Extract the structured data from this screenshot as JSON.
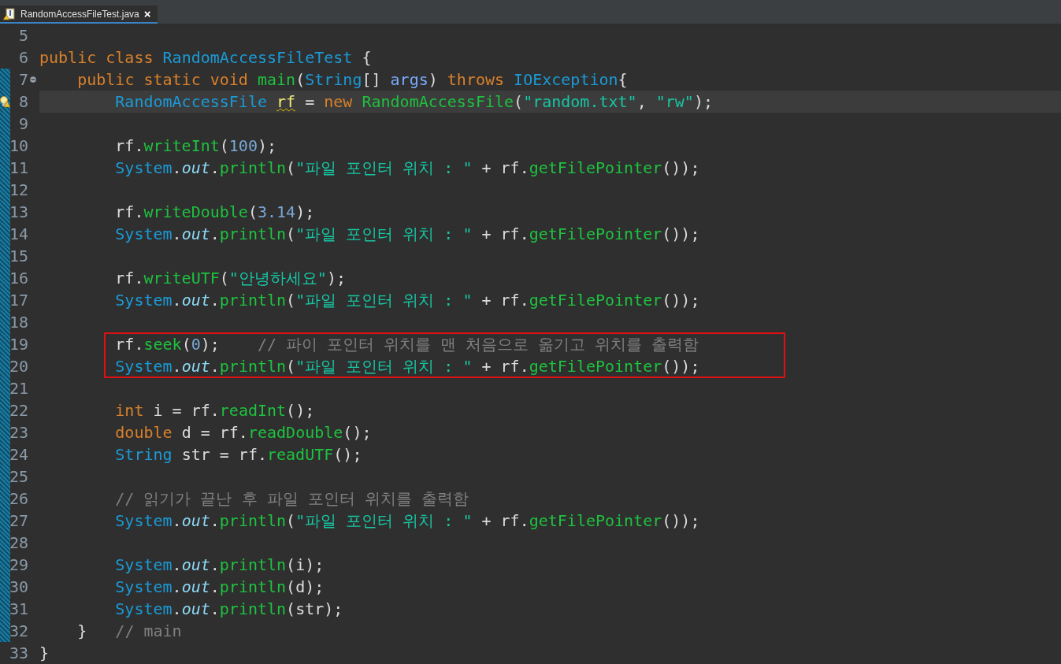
{
  "editor_tab": {
    "title": "RandomAccessFileTest.java",
    "selected": true,
    "close": "×"
  },
  "lines": [
    {
      "number": "5",
      "changed": false,
      "current": false,
      "boxed": false
    },
    {
      "number": "6",
      "changed": false,
      "current": false,
      "boxed": false,
      "tokens": [
        {
          "kind": "keyword",
          "text": "public class "
        },
        {
          "kind": "type",
          "text": "RandomAccessFileTest"
        },
        {
          "kind": "plain",
          "text": " {"
        }
      ]
    },
    {
      "number": "7",
      "changed": true,
      "current": false,
      "boxed": false,
      "fold": {
        "expanded": true
      },
      "tokens": [
        {
          "kind": "keyword",
          "text": "    public static void "
        },
        {
          "kind": "method",
          "text": "main"
        },
        {
          "kind": "plain",
          "text": "("
        },
        {
          "kind": "type",
          "text": "String"
        },
        {
          "kind": "plain",
          "text": "[] "
        },
        {
          "kind": "parameter",
          "text": "args"
        },
        {
          "kind": "plain",
          "text": ") "
        },
        {
          "kind": "keyword",
          "text": "throws "
        },
        {
          "kind": "type",
          "text": "IOException"
        },
        {
          "kind": "plain",
          "text": "{"
        }
      ]
    },
    {
      "number": "8",
      "changed": true,
      "current": true,
      "boxed": false,
      "warning": true,
      "tokens": [
        {
          "kind": "type",
          "text": "        RandomAccessFile "
        },
        {
          "kind": "variable",
          "text": "rf",
          "warning": true
        },
        {
          "kind": "plain",
          "text": " = "
        },
        {
          "kind": "keyword",
          "text": "new "
        },
        {
          "kind": "method",
          "text": "RandomAccessFile"
        },
        {
          "kind": "plain",
          "text": "("
        },
        {
          "kind": "string",
          "text": "\"random.txt\""
        },
        {
          "kind": "plain",
          "text": ", "
        },
        {
          "kind": "string",
          "text": "\"rw\""
        },
        {
          "kind": "plain",
          "text": ");"
        }
      ]
    },
    {
      "number": "9",
      "changed": true,
      "current": false,
      "boxed": false
    },
    {
      "number": "10",
      "changed": true,
      "current": false,
      "boxed": false,
      "tokens": [
        {
          "kind": "plain",
          "text": "        rf."
        },
        {
          "kind": "method",
          "text": "writeInt"
        },
        {
          "kind": "plain",
          "text": "("
        },
        {
          "kind": "number",
          "text": "100"
        },
        {
          "kind": "plain",
          "text": ");"
        }
      ]
    },
    {
      "number": "11",
      "changed": true,
      "current": false,
      "boxed": false,
      "tokens": [
        {
          "kind": "type",
          "text": "        System"
        },
        {
          "kind": "plain",
          "text": "."
        },
        {
          "kind": "field",
          "text": "out"
        },
        {
          "kind": "plain",
          "text": "."
        },
        {
          "kind": "method",
          "text": "println"
        },
        {
          "kind": "plain",
          "text": "("
        },
        {
          "kind": "string",
          "text": "\"파일 포인터 위치 : \""
        },
        {
          "kind": "plain",
          "text": " + rf."
        },
        {
          "kind": "method",
          "text": "getFilePointer"
        },
        {
          "kind": "plain",
          "text": "());"
        }
      ]
    },
    {
      "number": "12",
      "changed": true,
      "current": false,
      "boxed": false
    },
    {
      "number": "13",
      "changed": true,
      "current": false,
      "boxed": false,
      "tokens": [
        {
          "kind": "plain",
          "text": "        rf."
        },
        {
          "kind": "method",
          "text": "writeDouble"
        },
        {
          "kind": "plain",
          "text": "("
        },
        {
          "kind": "number",
          "text": "3.14"
        },
        {
          "kind": "plain",
          "text": ");"
        }
      ]
    },
    {
      "number": "14",
      "changed": true,
      "current": false,
      "boxed": false,
      "tokens": [
        {
          "kind": "type",
          "text": "        System"
        },
        {
          "kind": "plain",
          "text": "."
        },
        {
          "kind": "field",
          "text": "out"
        },
        {
          "kind": "plain",
          "text": "."
        },
        {
          "kind": "method",
          "text": "println"
        },
        {
          "kind": "plain",
          "text": "("
        },
        {
          "kind": "string",
          "text": "\"파일 포인터 위치 : \""
        },
        {
          "kind": "plain",
          "text": " + rf."
        },
        {
          "kind": "method",
          "text": "getFilePointer"
        },
        {
          "kind": "plain",
          "text": "());"
        }
      ]
    },
    {
      "number": "15",
      "changed": true,
      "current": false,
      "boxed": false
    },
    {
      "number": "16",
      "changed": true,
      "current": false,
      "boxed": false,
      "tokens": [
        {
          "kind": "plain",
          "text": "        rf."
        },
        {
          "kind": "method",
          "text": "writeUTF"
        },
        {
          "kind": "plain",
          "text": "("
        },
        {
          "kind": "string",
          "text": "\"안녕하세요\""
        },
        {
          "kind": "plain",
          "text": ");"
        }
      ]
    },
    {
      "number": "17",
      "changed": true,
      "current": false,
      "boxed": false,
      "tokens": [
        {
          "kind": "type",
          "text": "        System"
        },
        {
          "kind": "plain",
          "text": "."
        },
        {
          "kind": "field",
          "text": "out"
        },
        {
          "kind": "plain",
          "text": "."
        },
        {
          "kind": "method",
          "text": "println"
        },
        {
          "kind": "plain",
          "text": "("
        },
        {
          "kind": "string",
          "text": "\"파일 포인터 위치 : \""
        },
        {
          "kind": "plain",
          "text": " + rf."
        },
        {
          "kind": "method",
          "text": "getFilePointer"
        },
        {
          "kind": "plain",
          "text": "());"
        }
      ]
    },
    {
      "number": "18",
      "changed": true,
      "current": false,
      "boxed": false
    },
    {
      "number": "19",
      "changed": true,
      "current": false,
      "boxed": true,
      "tokens": [
        {
          "kind": "plain",
          "text": "        rf."
        },
        {
          "kind": "method",
          "text": "seek"
        },
        {
          "kind": "plain",
          "text": "("
        },
        {
          "kind": "number",
          "text": "0"
        },
        {
          "kind": "plain",
          "text": ");    "
        },
        {
          "kind": "comment",
          "text": "// 파이 포인터 위치를 맨 처음으로 옮기고 위치를 출력함"
        }
      ]
    },
    {
      "number": "20",
      "changed": true,
      "current": false,
      "boxed": true,
      "tokens": [
        {
          "kind": "type",
          "text": "        System"
        },
        {
          "kind": "plain",
          "text": "."
        },
        {
          "kind": "field",
          "text": "out"
        },
        {
          "kind": "plain",
          "text": "."
        },
        {
          "kind": "method",
          "text": "println"
        },
        {
          "kind": "plain",
          "text": "("
        },
        {
          "kind": "string",
          "text": "\"파일 포인터 위치 : \""
        },
        {
          "kind": "plain",
          "text": " + rf."
        },
        {
          "kind": "method",
          "text": "getFilePointer"
        },
        {
          "kind": "plain",
          "text": "());"
        }
      ]
    },
    {
      "number": "21",
      "changed": true,
      "current": false,
      "boxed": false
    },
    {
      "number": "22",
      "changed": true,
      "current": false,
      "boxed": false,
      "tokens": [
        {
          "kind": "keyword",
          "text": "        int "
        },
        {
          "kind": "plain",
          "text": "i = rf."
        },
        {
          "kind": "method",
          "text": "readInt"
        },
        {
          "kind": "plain",
          "text": "();"
        }
      ]
    },
    {
      "number": "23",
      "changed": true,
      "current": false,
      "boxed": false,
      "tokens": [
        {
          "kind": "keyword",
          "text": "        double "
        },
        {
          "kind": "plain",
          "text": "d = rf."
        },
        {
          "kind": "method",
          "text": "readDouble"
        },
        {
          "kind": "plain",
          "text": "();"
        }
      ]
    },
    {
      "number": "24",
      "changed": true,
      "current": false,
      "boxed": false,
      "tokens": [
        {
          "kind": "type",
          "text": "        String "
        },
        {
          "kind": "plain",
          "text": "str = rf."
        },
        {
          "kind": "method",
          "text": "readUTF"
        },
        {
          "kind": "plain",
          "text": "();"
        }
      ]
    },
    {
      "number": "25",
      "changed": true,
      "current": false,
      "boxed": false
    },
    {
      "number": "26",
      "changed": true,
      "current": false,
      "boxed": false,
      "tokens": [
        {
          "kind": "comment",
          "text": "        // 읽기가 끝난 후 파일 포인터 위치를 출력함"
        }
      ]
    },
    {
      "number": "27",
      "changed": true,
      "current": false,
      "boxed": false,
      "tokens": [
        {
          "kind": "type",
          "text": "        System"
        },
        {
          "kind": "plain",
          "text": "."
        },
        {
          "kind": "field",
          "text": "out"
        },
        {
          "kind": "plain",
          "text": "."
        },
        {
          "kind": "method",
          "text": "println"
        },
        {
          "kind": "plain",
          "text": "("
        },
        {
          "kind": "string",
          "text": "\"파일 포인터 위치 : \""
        },
        {
          "kind": "plain",
          "text": " + rf."
        },
        {
          "kind": "method",
          "text": "getFilePointer"
        },
        {
          "kind": "plain",
          "text": "());"
        }
      ]
    },
    {
      "number": "28",
      "changed": true,
      "current": false,
      "boxed": false
    },
    {
      "number": "29",
      "changed": true,
      "current": false,
      "boxed": false,
      "tokens": [
        {
          "kind": "type",
          "text": "        System"
        },
        {
          "kind": "plain",
          "text": "."
        },
        {
          "kind": "field",
          "text": "out"
        },
        {
          "kind": "plain",
          "text": "."
        },
        {
          "kind": "method",
          "text": "println"
        },
        {
          "kind": "plain",
          "text": "(i);"
        }
      ]
    },
    {
      "number": "30",
      "changed": true,
      "current": false,
      "boxed": false,
      "tokens": [
        {
          "kind": "type",
          "text": "        System"
        },
        {
          "kind": "plain",
          "text": "."
        },
        {
          "kind": "field",
          "text": "out"
        },
        {
          "kind": "plain",
          "text": "."
        },
        {
          "kind": "method",
          "text": "println"
        },
        {
          "kind": "plain",
          "text": "(d);"
        }
      ]
    },
    {
      "number": "31",
      "changed": true,
      "current": false,
      "boxed": false,
      "tokens": [
        {
          "kind": "type",
          "text": "        System"
        },
        {
          "kind": "plain",
          "text": "."
        },
        {
          "kind": "field",
          "text": "out"
        },
        {
          "kind": "plain",
          "text": "."
        },
        {
          "kind": "method",
          "text": "println"
        },
        {
          "kind": "plain",
          "text": "(str);"
        }
      ]
    },
    {
      "number": "32",
      "changed": true,
      "current": false,
      "boxed": false,
      "tokens": [
        {
          "kind": "plain",
          "text": "    }   "
        },
        {
          "kind": "comment",
          "text": "// main"
        }
      ]
    },
    {
      "number": "33",
      "changed": false,
      "current": false,
      "boxed": false,
      "tokens": [
        {
          "kind": "plain",
          "text": "}"
        }
      ]
    }
  ]
}
